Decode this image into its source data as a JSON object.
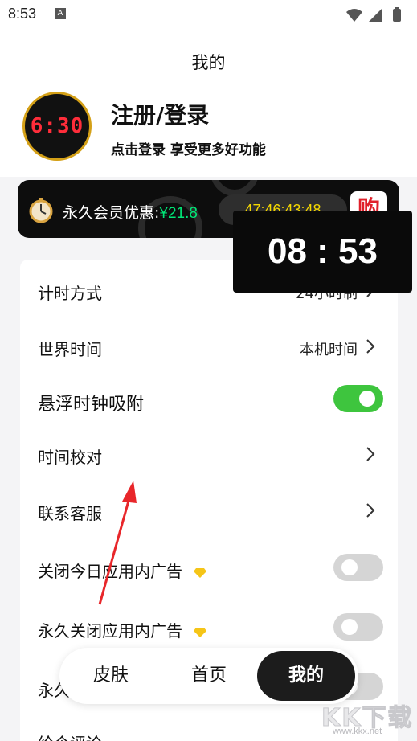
{
  "status_bar": {
    "time": "8:53",
    "notification_badge": "A",
    "icons": [
      "wifi-icon",
      "signal-icon",
      "battery-icon"
    ]
  },
  "header": {
    "title": "我的"
  },
  "profile": {
    "avatar_text": "6:30",
    "login_title": "注册/登录",
    "login_subtitle": "点击登录 享受更多好功能"
  },
  "vip_banner": {
    "label": "永久会员优惠:",
    "price": "¥21.8",
    "countdown": "47:46:43:48",
    "buy_label": "购"
  },
  "floating_clock": {
    "time": "08 : 53"
  },
  "settings": {
    "timing_mode": {
      "label": "计时方式",
      "value": "24小时制"
    },
    "world_time": {
      "label": "世界时间",
      "value": "本机时间"
    },
    "float_attach": {
      "label": "悬浮时钟吸附",
      "enabled": true
    },
    "time_calibration": {
      "label": "时间校对"
    },
    "customer_service": {
      "label": "联系客服"
    },
    "close_ads_today": {
      "label": "关闭今日应用内广告",
      "enabled": false
    },
    "close_ads_forever": {
      "label": "永久关闭应用内广告",
      "enabled": false
    },
    "partial_row": {
      "label": "永久"
    },
    "partial_row_2": {
      "label": "给个评论"
    }
  },
  "bottom_nav": {
    "items": [
      {
        "label": "皮肤",
        "active": false
      },
      {
        "label": "首页",
        "active": false
      },
      {
        "label": "我的",
        "active": true
      }
    ]
  },
  "watermark": {
    "text": "KK下载",
    "url": "www.kkx.net"
  },
  "colors": {
    "toggle_on": "#3ec53e",
    "toggle_off": "#d5d5d5",
    "price_green": "#00e676",
    "timer_yellow": "#f5d800",
    "arrow_red": "#e8262a"
  }
}
